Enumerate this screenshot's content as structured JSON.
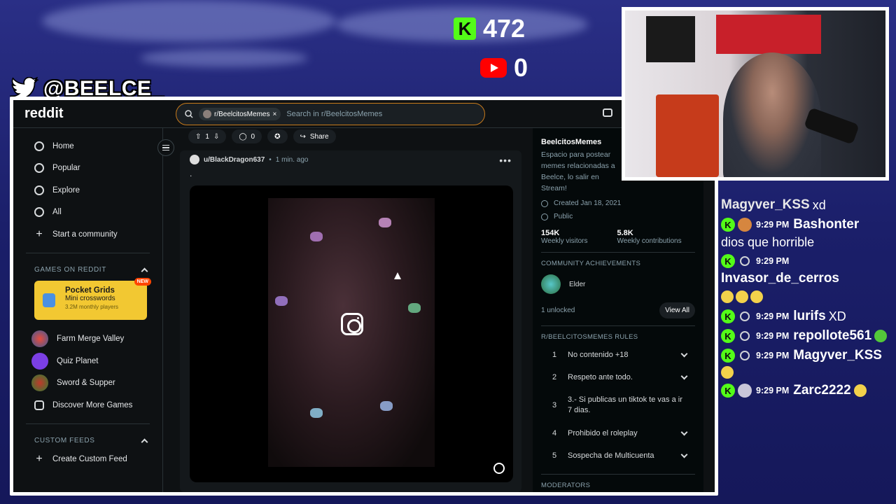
{
  "overlay": {
    "kick_count": "472",
    "youtube_count": "0",
    "twitter_handle": "@BEELCE_",
    "kick_letter": "K"
  },
  "reddit": {
    "logo": "reddit",
    "search": {
      "community_chip": "r/BeelcitosMemes",
      "placeholder": "Search in r/BeelcitosMemes"
    },
    "nav": [
      {
        "label": "Home",
        "icon": "home-icon"
      },
      {
        "label": "Popular",
        "icon": "popular-icon"
      },
      {
        "label": "Explore",
        "icon": "explore-icon"
      },
      {
        "label": "All",
        "icon": "all-icon"
      },
      {
        "label": "Start a community",
        "icon": "plus-icon"
      }
    ],
    "games_title": "GAMES ON REDDIT",
    "featured_game": {
      "name": "Pocket Grids",
      "subtitle": "Mini crosswords",
      "players": "3.2M monthly players",
      "badge": "NEW"
    },
    "games": [
      "Farm Merge Valley",
      "Quiz Planet",
      "Sword & Supper",
      "Discover More Games"
    ],
    "custom_feeds_title": "CUSTOM FEEDS",
    "create_feed": "Create Custom Feed",
    "post": {
      "votes": "1",
      "comments": "0",
      "share": "Share",
      "author": "u/BlackDragon637",
      "separator": "•",
      "time": "1 min. ago",
      "title": "."
    },
    "community": {
      "name": "BeelcitosMemes",
      "description": "Espacio para postear memes relacionadas a Beelce, lo salir en Stream!",
      "created": "Created Jan 18, 2021",
      "visibility": "Public",
      "stats": [
        {
          "value": "154K",
          "label": "Weekly visitors"
        },
        {
          "value": "5.8K",
          "label": "Weekly contributions"
        }
      ],
      "achievements_title": "COMMUNITY ACHIEVEMENTS",
      "achievement": "Elder",
      "unlocked": "1 unlocked",
      "view_all": "View All",
      "rules_title": "R/BEELCITOSMEMES RULES",
      "rules": [
        {
          "n": "1",
          "text": "No contenido +18"
        },
        {
          "n": "2",
          "text": "Respeto ante todo."
        },
        {
          "n": "3",
          "text": "3.- Si publicas un tiktok te vas a ir 7 dias."
        },
        {
          "n": "4",
          "text": "Prohibido el roleplay"
        },
        {
          "n": "5",
          "text": "Sospecha de Multicuenta"
        }
      ],
      "moderators_title": "MODERATORS"
    }
  },
  "chat": [
    {
      "user": "Magyver_KSS",
      "time": "",
      "text": "xd"
    },
    {
      "user": "Bashonter",
      "time": "9:29 PM",
      "text": "dios que horrible"
    },
    {
      "user": "Invasor_de_cerros",
      "time": "9:29 PM",
      "text": ""
    },
    {
      "user": "lurifs",
      "time": "9:29 PM",
      "text": "XD"
    },
    {
      "user": "repollote561",
      "time": "9:29 PM",
      "text": ""
    },
    {
      "user": "Magyver_KSS",
      "time": "9:29 PM",
      "text": ""
    },
    {
      "user": "Zarc2222",
      "time": "9:29 PM",
      "text": ""
    }
  ],
  "colors": {
    "kick": "#53fc18",
    "youtube": "#ff0000",
    "reddit_bg": "#0e1113",
    "search_border": "#c77a1b",
    "pocket": "#f2c832"
  }
}
